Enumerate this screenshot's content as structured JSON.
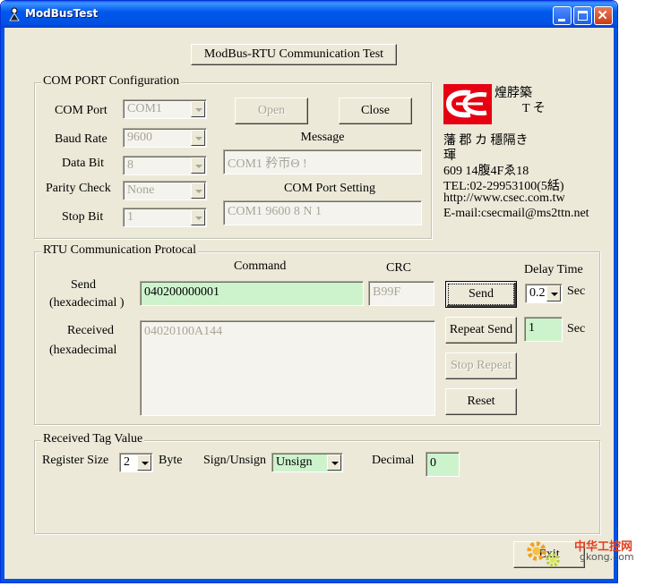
{
  "window": {
    "title": "ModBusTest",
    "header_button": "ModBus-RTU Communication Test"
  },
  "com_port": {
    "legend": "COM PORT Configuration",
    "com_port_label": "COM Port",
    "com_port_value": "COM1",
    "baud_rate_label": "Baud Rate",
    "baud_rate_value": "9600",
    "data_bit_label": "Data Bit",
    "data_bit_value": "8",
    "parity_label": "Parity Check",
    "parity_value": "None",
    "stop_bit_label": "Stop Bit",
    "stop_bit_value": "1",
    "open_label": "Open",
    "close_label": "Close",
    "message_label": "Message",
    "message_value": "COM1 矜帀Θ   !",
    "setting_label": "COM Port Setting",
    "setting_value": "COM1 9600 8 N 1"
  },
  "company": {
    "line1": "煌脖築",
    "line2": "T    そ",
    "line3": "藩   郡         カ     穩隔き",
    "line4": "琿",
    "line5": "609    14腹4Fゑ18",
    "tel": "TEL:02-29953100(5絬)",
    "web": "http://www.csec.com.tw",
    "email": "E-mail:csecmail@ms2ttn.net"
  },
  "rtu": {
    "legend": "RTU Communication Protocal",
    "command_label": "Command",
    "crc_label": "CRC",
    "delay_label": "Delay Time",
    "send_label_1": "Send",
    "send_label_2": "(hexadecimal )",
    "send_value": "040200000001",
    "crc_value": "B99F",
    "send_button": "Send",
    "delay_value": "0.2",
    "sec_1": "Sec",
    "received_label_1": "Received",
    "received_label_2": "(hexadecimal",
    "received_value": "04020100A144",
    "repeat_send_button": "Repeat Send",
    "repeat_value": "1",
    "sec_2": "Sec",
    "stop_repeat_button": "Stop Repeat",
    "reset_button": "Reset"
  },
  "tag": {
    "legend": "Received Tag Value",
    "register_size_label": "Register Size",
    "register_size_value": "2",
    "byte_label": "Byte",
    "sign_label": "Sign/Unsign",
    "sign_value": "Unsign",
    "decimal_label": "Decimal",
    "decimal_value": "0"
  },
  "footer": {
    "exit_button": "Exit",
    "watermark_cn": "中华工控网",
    "watermark_url": "gkong.com"
  },
  "colors": {
    "window_bg": "#ece9d8",
    "titlebar": "#0054e3",
    "field_green": "#cdf3cd",
    "logo_red": "#e60012"
  }
}
